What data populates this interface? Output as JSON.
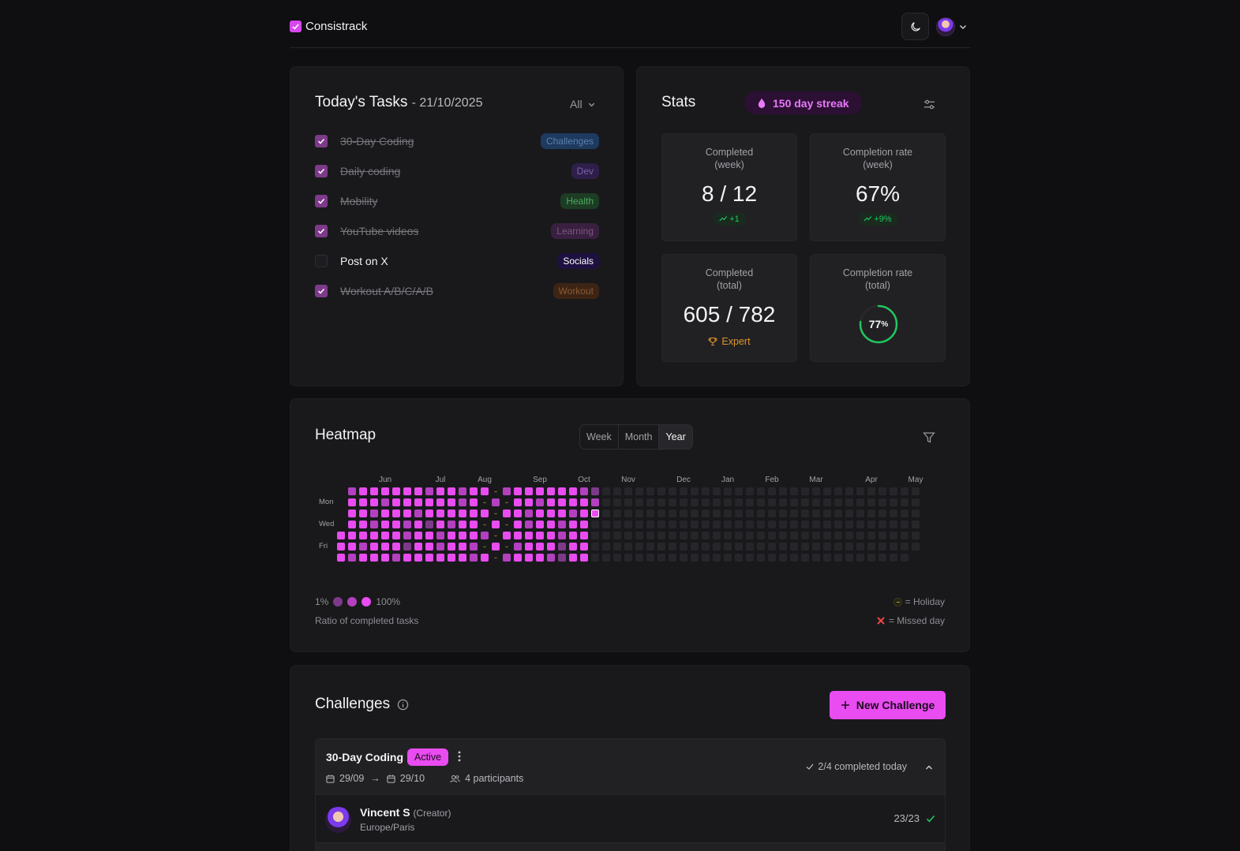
{
  "app": {
    "name": "Consistrack"
  },
  "header": {
    "theme_icon": "moon-icon",
    "avatar_icon": "user-avatar"
  },
  "tasks": {
    "title": "Today's Tasks",
    "date": "- 21/10/2025",
    "filter": "All",
    "items": [
      {
        "label": "30-Day Coding",
        "tag": "Challenges",
        "done": true,
        "tag_bg": "#1e3a5f",
        "tag_fg": "#5b7fae"
      },
      {
        "label": "Daily coding",
        "tag": "Dev",
        "done": true,
        "tag_bg": "#2e1f4a",
        "tag_fg": "#7a62a8"
      },
      {
        "label": "Mobility",
        "tag": "Health",
        "done": true,
        "tag_bg": "#1c3d24",
        "tag_fg": "#4ea860"
      },
      {
        "label": "YouTube videos",
        "tag": "Learning",
        "done": true,
        "tag_bg": "#3a2040",
        "tag_fg": "#7a5580"
      },
      {
        "label": "Post on X",
        "tag": "Socials",
        "done": false,
        "tag_bg": "#1e1040",
        "tag_fg": "#ffffff"
      },
      {
        "label": "Workout A/B/C/A/B",
        "tag": "Workout",
        "done": true,
        "tag_bg": "#3d2414",
        "tag_fg": "#8a5a33"
      }
    ]
  },
  "stats": {
    "title": "Stats",
    "streak": "150 day streak",
    "cards": {
      "week_completed": {
        "label1": "Completed",
        "label2": "(week)",
        "value": "8 / 12",
        "delta": "+1"
      },
      "week_rate": {
        "label1": "Completion rate",
        "label2": "(week)",
        "value": "67%",
        "delta": "+9%"
      },
      "total_completed": {
        "label1": "Completed",
        "label2": "(total)",
        "value": "605 / 782",
        "level": "Expert"
      },
      "total_rate": {
        "label1": "Completion rate",
        "label2": "(total)",
        "value_num": "77",
        "value_unit": "%",
        "fraction": 0.77
      }
    }
  },
  "heatmap": {
    "title": "Heatmap",
    "ranges": [
      "Week",
      "Month",
      "Year"
    ],
    "selected_range": "Year",
    "months": [
      "Jun",
      "Jul",
      "Aug",
      "Sep",
      "Oct",
      "Nov",
      "Dec",
      "Jan",
      "Feb",
      "Mar",
      "Apr",
      "May"
    ],
    "days": [
      "Mon",
      "Wed",
      "Fri"
    ],
    "legend_min": "1%",
    "legend_max": "100%",
    "legend_caption": "Ratio of completed tasks",
    "holiday_label": "= Holiday",
    "missed_label": "= Missed day",
    "colors": {
      "low": "#7e3a8a",
      "mid": "#b440c0",
      "high": "#e94cf0",
      "empty": "#26262a",
      "holiday": "#8a8a20"
    }
  },
  "challenges": {
    "title": "Challenges",
    "new_button": "New Challenge",
    "item": {
      "name": "30-Day Coding",
      "status": "Active",
      "start": "29/09",
      "arrow": "→",
      "end": "29/10",
      "participants": "4 participants",
      "completed_today": "2/4 completed today",
      "member": {
        "name": "Vincent S",
        "role": "(Creator)",
        "timezone": "Europe/Paris",
        "score": "23/23"
      }
    }
  }
}
